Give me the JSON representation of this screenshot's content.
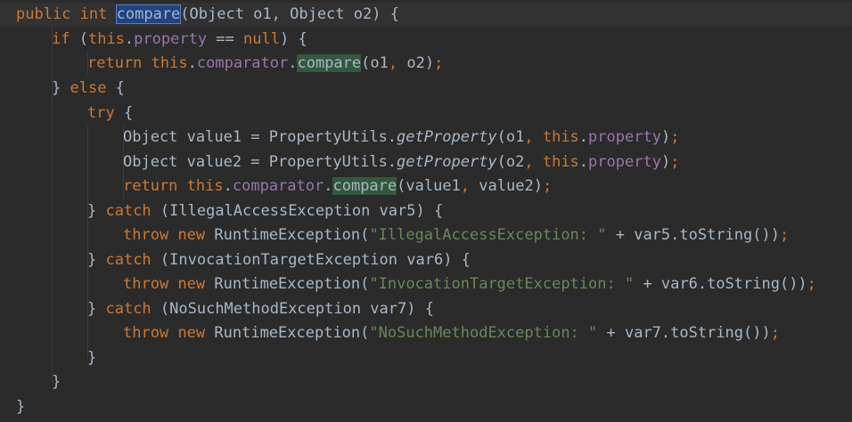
{
  "code": {
    "l1_kw_public": "public",
    "l1_kw_int": "int",
    "l1_method": "compare",
    "l1_params": "(Object o1, Object o2) {",
    "l2_kw_if": "if",
    "l2_open": " (",
    "l2_this": "this",
    "l2_dot": ".",
    "l2_field": "property",
    "l2_eq": " == ",
    "l2_null": "null",
    "l2_close": ") {",
    "l3_return": "return",
    "l3_this": "this",
    "l3_dot1": ".",
    "l3_field": "comparator",
    "l3_dot2": ".",
    "l3_method": "compare",
    "l3_args": "(o1",
    "l3_comma": ",",
    "l3_args2": " o2)",
    "l3_semi": ";",
    "l4_brace": "} ",
    "l4_else": "else",
    "l4_open": " {",
    "l5_try": "try",
    "l5_open": " {",
    "l6_type": "Object value1 = PropertyUtils.",
    "l6_method": "getProperty",
    "l6_args": "(o1",
    "l6_comma": ", ",
    "l6_this": "this",
    "l6_dot": ".",
    "l6_field": "property",
    "l6_close": ")",
    "l6_semi": ";",
    "l7_type": "Object value2 = PropertyUtils.",
    "l7_method": "getProperty",
    "l7_args": "(o2",
    "l7_comma": ", ",
    "l7_this": "this",
    "l7_dot": ".",
    "l7_field": "property",
    "l7_close": ")",
    "l7_semi": ";",
    "l8_return": "return",
    "l8_this": "this",
    "l8_dot1": ".",
    "l8_field": "comparator",
    "l8_dot2": ".",
    "l8_method": "compare",
    "l8_args": "(value1",
    "l8_comma": ",",
    "l8_args2": " value2)",
    "l8_semi": ";",
    "l9_brace": "} ",
    "l9_catch": "catch",
    "l9_rest": " (IllegalAccessException var5) {",
    "l10_throw": "throw",
    "l10_new": "new",
    "l10_cls": " RuntimeException(",
    "l10_str": "\"IllegalAccessException: \"",
    "l10_rest": " + var5.toString())",
    "l10_semi": ";",
    "l11_brace": "} ",
    "l11_catch": "catch",
    "l11_rest": " (InvocationTargetException var6) {",
    "l12_throw": "throw",
    "l12_new": "new",
    "l12_cls": " RuntimeException(",
    "l12_str": "\"InvocationTargetException: \"",
    "l12_rest": " + var6.toString())",
    "l12_semi": ";",
    "l13_brace": "} ",
    "l13_catch": "catch",
    "l13_rest": " (NoSuchMethodException var7) {",
    "l14_throw": "throw",
    "l14_new": "new",
    "l14_cls": " RuntimeException(",
    "l14_str": "\"NoSuchMethodException: \"",
    "l14_rest": " + var7.toString())",
    "l14_semi": ";",
    "l15_brace": "}",
    "l16_brace": "}",
    "l17_brace": "}"
  },
  "colors": {
    "background": "#2b2b2b",
    "keyword": "#cc7832",
    "field": "#9876aa",
    "string": "#6a8759",
    "text": "#a9b7c6",
    "selection": "#214283",
    "usage_highlight": "#32593d"
  }
}
